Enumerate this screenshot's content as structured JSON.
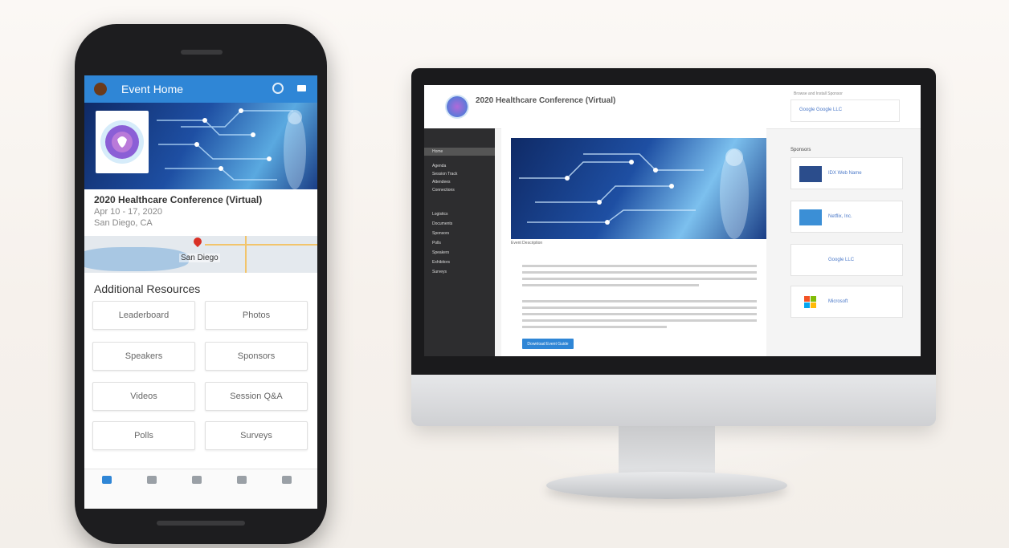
{
  "phone": {
    "appbar_title": "Event Home",
    "event_title": "2020 Healthcare Conference (Virtual)",
    "event_dates": "Apr 10 - 17, 2020",
    "event_location": "San Diego, CA",
    "map_label": "San Diego",
    "section_title": "Additional Resources",
    "tiles": [
      "Leaderboard",
      "Photos",
      "Speakers",
      "Sponsors",
      "Videos",
      "Session Q&A",
      "Polls",
      "Surveys"
    ]
  },
  "web": {
    "title": "2020 Healthcare Conference (Virtual)",
    "header_hint": "Browse and Install Sponsor",
    "header_sponsor": "Google  Google LLC",
    "nav": [
      "Home",
      "Agenda",
      "Session Track",
      "Attendees",
      "Connections",
      "Logistics",
      "Documents",
      "Sponsors",
      "Polls",
      "Speakers",
      "Exhibitors",
      "Surveys"
    ],
    "desc_label": "Event Description",
    "button_label": "Download Event Guide",
    "sponsors_label": "Sponsors",
    "sponsors": [
      {
        "name": "IDX Web Name",
        "color": "#2b4d8c"
      },
      {
        "name": "Netflix, Inc.",
        "color": "#3b8fd6"
      },
      {
        "name": "Google LLC",
        "color": "#ffffff"
      },
      {
        "name": "Microsoft",
        "color": "#ffffff"
      }
    ]
  },
  "colors": {
    "accent": "#2f86d6",
    "dark_sidebar": "#2d2d2f"
  }
}
